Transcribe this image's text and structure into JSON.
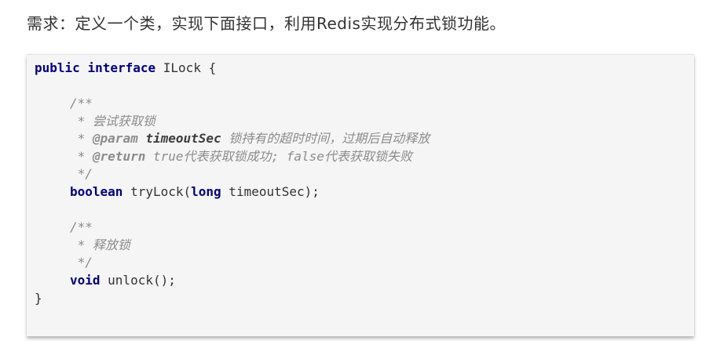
{
  "heading": "需求：定义一个类，实现下面接口，利用Redis实现分布式锁功能。",
  "code": {
    "interface_decl": {
      "kw_public": "public",
      "kw_interface": "interface",
      "name": "ILock {"
    },
    "doc1": {
      "open": "/**",
      "star": " * ",
      "desc": "尝试获取锁",
      "param_tag": "@param",
      "param_name": "timeoutSec",
      "param_desc": " 锁持有的超时时间，过期后自动释放",
      "return_tag": "@return",
      "return_desc": " true代表获取锁成功; false代表获取锁失败",
      "close": " */"
    },
    "method1": {
      "kw_boolean": "boolean",
      "name": " tryLock(",
      "kw_long": "long",
      "params": " timeoutSec);"
    },
    "doc2": {
      "open": "/**",
      "star": " * ",
      "desc": "释放锁",
      "close": " */"
    },
    "method2": {
      "kw_void": "void",
      "name": " unlock();"
    },
    "close_brace": "}"
  }
}
